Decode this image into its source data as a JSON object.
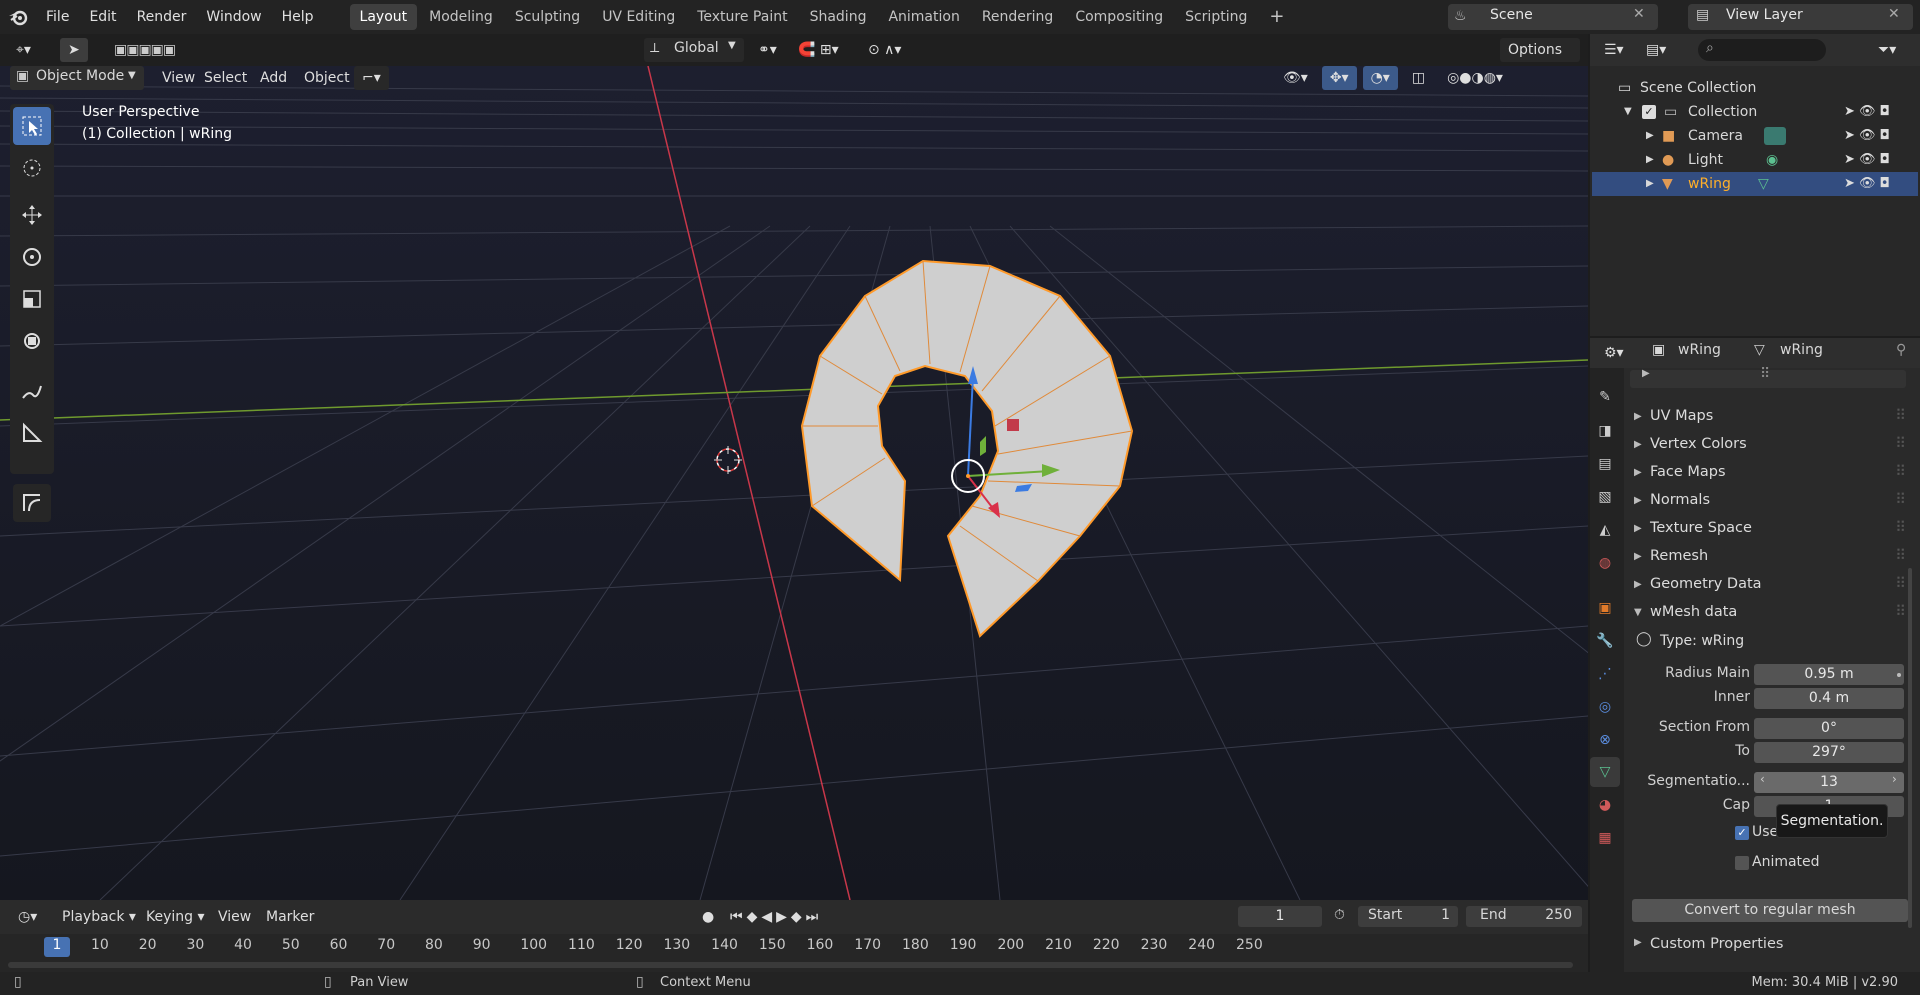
{
  "menus": [
    "File",
    "Edit",
    "Render",
    "Window",
    "Help"
  ],
  "workspaces": [
    "Layout",
    "Modeling",
    "Sculpting",
    "UV Editing",
    "Texture Paint",
    "Shading",
    "Animation",
    "Rendering",
    "Compositing",
    "Scripting"
  ],
  "scene": "Scene",
  "view_layer": "View Layer",
  "header": {
    "transform": "Global",
    "options": "Options"
  },
  "viewport": {
    "mode": "Object Mode",
    "menus": [
      "View",
      "Select",
      "Add",
      "Object"
    ],
    "title": "User Perspective",
    "subtitle": "(1) Collection | wRing"
  },
  "outliner": {
    "root": "Scene Collection",
    "collection": "Collection",
    "items": [
      "Camera",
      "Light",
      "wRing"
    ]
  },
  "properties": {
    "object_name": "wRing",
    "data_name": "wRing",
    "panels": [
      "UV Maps",
      "Vertex Colors",
      "Face Maps",
      "Normals",
      "Texture Space",
      "Remesh",
      "Geometry Data",
      "wMesh data"
    ],
    "type_label": "Type: wRing",
    "radius_main_label": "Radius Main",
    "radius_main": "0.95 m",
    "inner_label": "Inner",
    "inner": "0.4 m",
    "section_from_label": "Section From",
    "section_from": "0°",
    "to_label": "To",
    "to": "297°",
    "segmentation_label": "Segmentatio...",
    "segmentation": "13",
    "cap_label": "Cap",
    "cap": "1",
    "use_label": "Use",
    "animated_label": "Animated",
    "convert_button": "Convert to regular mesh",
    "custom_properties": "Custom Properties",
    "tooltip": "Segmentation."
  },
  "timeline": {
    "menus": [
      "Playback",
      "Keying",
      "View",
      "Marker"
    ],
    "current_frame": "1",
    "start_label": "Start",
    "start": "1",
    "end_label": "End",
    "end": "250",
    "ticks": [
      "1",
      "10",
      "20",
      "30",
      "40",
      "50",
      "60",
      "70",
      "80",
      "90",
      "100",
      "110",
      "120",
      "130",
      "140",
      "150",
      "160",
      "170",
      "180",
      "190",
      "200",
      "210",
      "220",
      "230",
      "240",
      "250"
    ]
  },
  "statusbar": {
    "pan": "Pan View",
    "context": "Context Menu",
    "memory": "Mem: 30.4 MiB | v2.90"
  },
  "colors": {
    "accent": "#4772b3",
    "selected": "#ffaf29",
    "x_axis": "#d13a4a",
    "y_axis": "#7bb030"
  }
}
